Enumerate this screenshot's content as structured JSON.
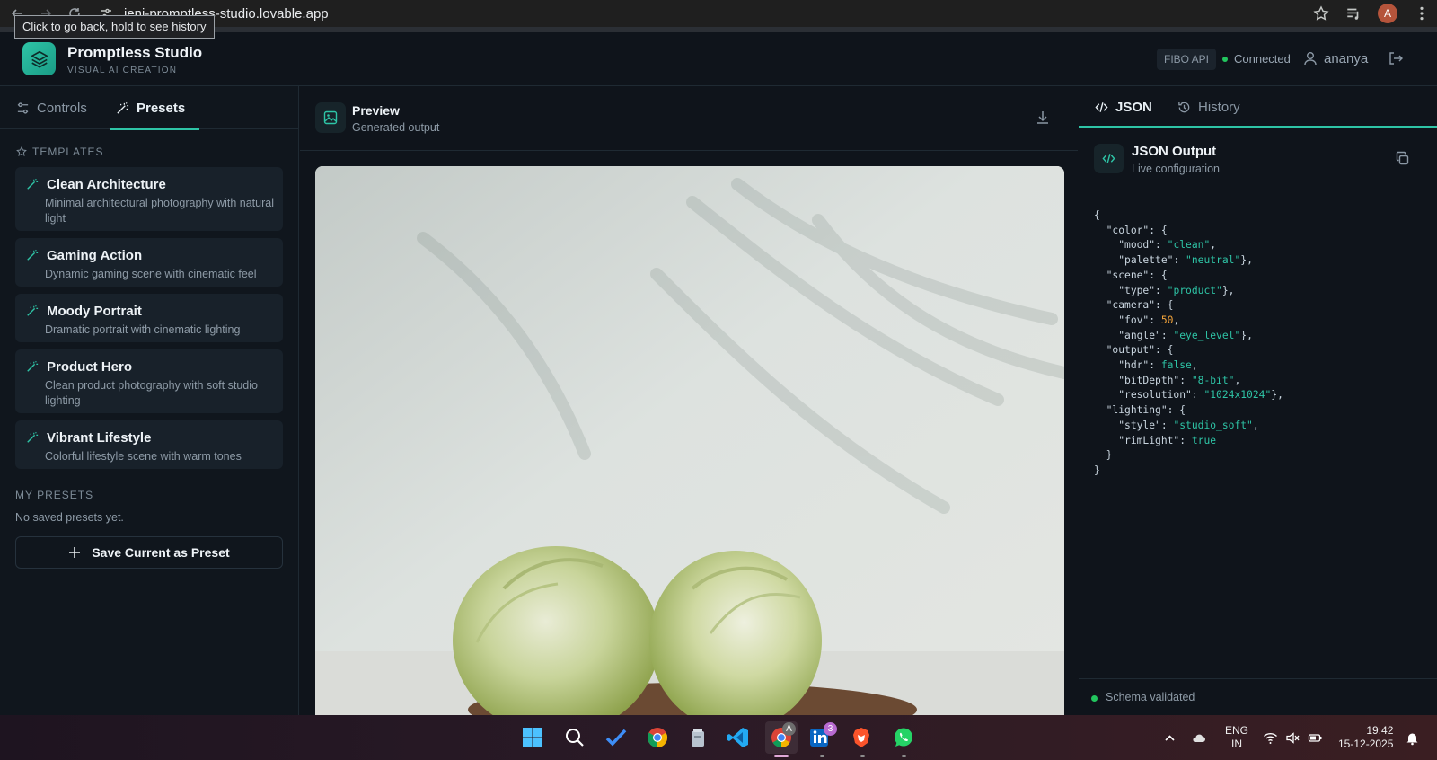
{
  "browser": {
    "url": "ieni-promptless-studio.lovable.app",
    "tooltip": "Click to go back, hold to see history",
    "profile_initial": "A"
  },
  "header": {
    "brand_name": "Promptless Studio",
    "brand_sub": "VISUAL AI CREATION",
    "api_badge": "FIBO API",
    "status": "Connected",
    "user": "ananya",
    "accent": "#2ec4a6"
  },
  "left": {
    "tabs": [
      {
        "label": "Controls",
        "icon": "sliders-icon",
        "active": false
      },
      {
        "label": "Presets",
        "icon": "wand-icon",
        "active": true
      }
    ],
    "templates_label": "TEMPLATES",
    "templates": [
      {
        "name": "Clean Architecture",
        "desc": "Minimal architectural photography with natural light"
      },
      {
        "name": "Gaming Action",
        "desc": "Dynamic gaming scene with cinematic feel"
      },
      {
        "name": "Moody Portrait",
        "desc": "Dramatic portrait with cinematic lighting"
      },
      {
        "name": "Product Hero",
        "desc": "Clean product photography with soft studio lighting"
      },
      {
        "name": "Vibrant Lifestyle",
        "desc": "Colorful lifestyle scene with warm tones"
      }
    ],
    "my_presets_label": "MY PRESETS",
    "no_presets": "No saved presets yet.",
    "save_button": "Save Current as Preset"
  },
  "preview": {
    "title": "Preview",
    "subtitle": "Generated output"
  },
  "right": {
    "tabs": [
      {
        "label": "JSON",
        "icon": "code-icon",
        "active": true
      },
      {
        "label": "History",
        "icon": "history-icon",
        "active": false
      }
    ],
    "json_title": "JSON Output",
    "json_sub": "Live configuration",
    "schema_status": "Schema validated"
  },
  "json_output": {
    "color": {
      "mood": "clean",
      "palette": "neutral"
    },
    "scene": {
      "type": "product"
    },
    "camera": {
      "fov": 50,
      "angle": "eye_level"
    },
    "output": {
      "hdr": false,
      "bitDepth": "8-bit",
      "resolution": "1024x1024"
    },
    "lighting": {
      "style": "studio_soft",
      "rimLight": true
    }
  },
  "taskbar": {
    "linkedin_badge": "3",
    "chrome_badge": "A",
    "lang_top": "ENG",
    "lang_bottom": "IN",
    "time": "19:42",
    "date": "15-12-2025"
  }
}
